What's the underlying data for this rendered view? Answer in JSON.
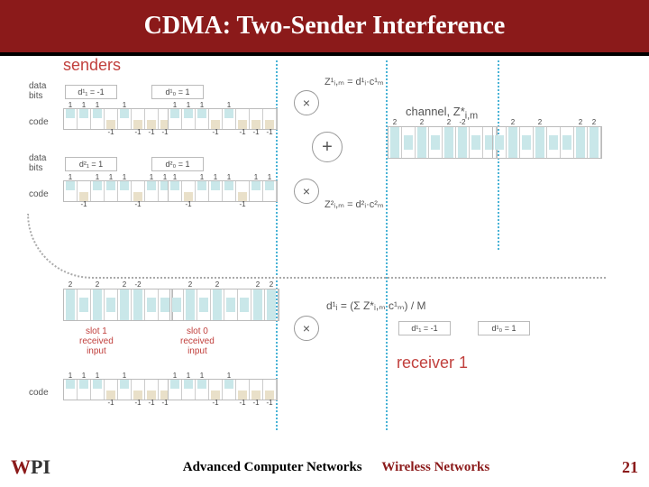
{
  "title": "CDMA: Two-Sender Interference",
  "footer": {
    "course": "Advanced Computer Networks",
    "topic": "Wireless Networks",
    "page": "21",
    "logo_w": "W",
    "logo_pi": "PI"
  },
  "labels": {
    "senders": "senders",
    "receiver": "receiver 1",
    "databits": "data\nbits",
    "code": "code",
    "channel": "channel, Z*",
    "channel_sub": "i,m",
    "z1": "Z¹ᵢ,ₘ = d¹ᵢ·c¹ₘ",
    "z2": "Z²ᵢ,ₘ = d²ᵢ·c²ₘ",
    "slot1r": "slot 1\nreceived\ninput",
    "slot0r": "slot 0\nreceived\ninput",
    "d_top_a": "d¹₁ = -1",
    "d_top_b": "d¹₀ = 1",
    "d_bot_a": "d²₁ = 1",
    "d_bot_b": "d²₀ = 1",
    "d_rx_a": "d¹₁ = -1",
    "d_rx_b": "d¹₀ = 1",
    "decode": "d¹ᵢ = (Σ Z*ᵢ,ₘ c¹ₘ) / M",
    "plus": "+",
    "times": "×"
  },
  "code_chips_1": [
    1,
    1,
    1,
    -1,
    1,
    -1,
    -1,
    -1
  ],
  "code_chips_1b": [
    1,
    1,
    1,
    -1,
    1,
    -1,
    -1,
    -1
  ],
  "code_chips_2": [
    1,
    -1,
    1,
    1,
    1,
    -1,
    1,
    1
  ],
  "code_chips_2b": [
    1,
    -1,
    1,
    1,
    1,
    -1,
    1,
    1
  ],
  "channel_vals_a": [
    2,
    0,
    2,
    0,
    2,
    -2,
    0,
    0
  ],
  "channel_vals_b": [
    0,
    2,
    0,
    2,
    0,
    0,
    2,
    2
  ],
  "rx_a": [
    2,
    0,
    2,
    0,
    2,
    -2,
    0,
    0
  ],
  "rx_b": [
    0,
    2,
    0,
    2,
    0,
    0,
    2,
    2
  ],
  "rx_code": [
    1,
    1,
    1,
    -1,
    1,
    -1,
    -1,
    -1
  ]
}
